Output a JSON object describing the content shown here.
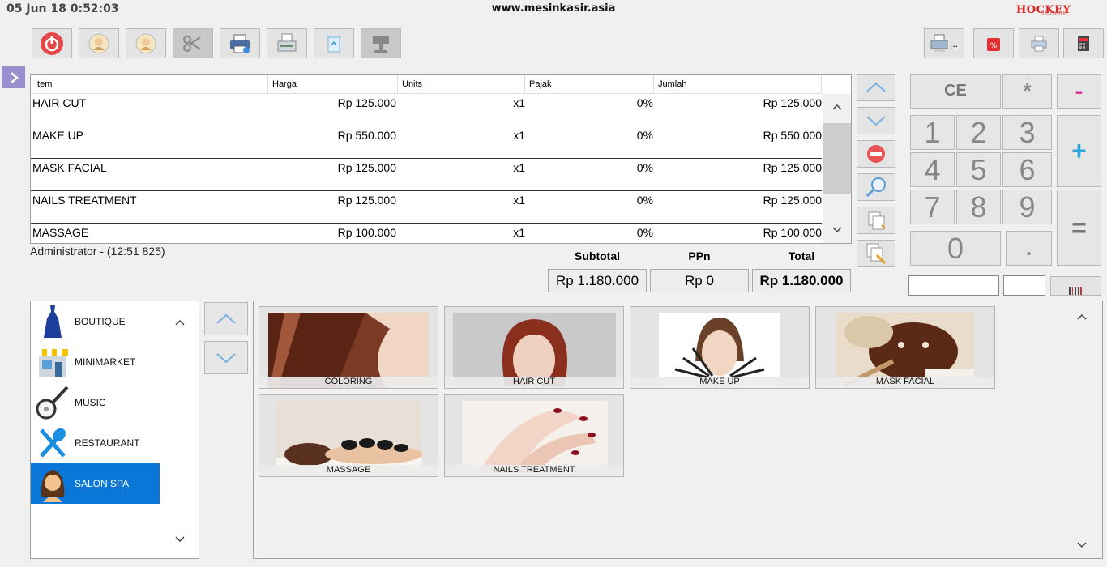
{
  "header": {
    "datetime": "05 Jun 18  0:52:03",
    "website": "www.mesinkasir.asia",
    "logo_text": "HOCKEY",
    "logo_sub": "Software"
  },
  "toolbar": {
    "buttons": [
      {
        "icon": "power-icon",
        "enabled": true
      },
      {
        "icon": "user-login-icon",
        "enabled": true
      },
      {
        "icon": "user-logout-icon",
        "enabled": true
      },
      {
        "icon": "cut-icon",
        "enabled": false
      },
      {
        "icon": "print-icon",
        "enabled": true
      },
      {
        "icon": "receipt-printer-icon",
        "enabled": true
      },
      {
        "icon": "recycle-bin-icon",
        "enabled": true
      },
      {
        "icon": "cashier-desk-icon",
        "enabled": false
      }
    ],
    "right_more_label": "..."
  },
  "grid": {
    "columns": [
      "Item",
      "Harga",
      "Units",
      "Pajak",
      "Jumlah"
    ],
    "rows": [
      {
        "item": "HAIR CUT",
        "harga": "Rp 125.000",
        "units": "x1",
        "pajak": "0%",
        "jumlah": "Rp 125.000"
      },
      {
        "item": "MAKE UP",
        "harga": "Rp 550.000",
        "units": "x1",
        "pajak": "0%",
        "jumlah": "Rp 550.000"
      },
      {
        "item": "MASK FACIAL",
        "harga": "Rp 125.000",
        "units": "x1",
        "pajak": "0%",
        "jumlah": "Rp 125.000"
      },
      {
        "item": "NAILS TREATMENT",
        "harga": "Rp 125.000",
        "units": "x1",
        "pajak": "0%",
        "jumlah": "Rp 125.000"
      },
      {
        "item": "MASSAGE",
        "harga": "Rp 100.000",
        "units": "x1",
        "pajak": "0%",
        "jumlah": "Rp 100.000"
      }
    ]
  },
  "status": {
    "user": "Administrator - (12:51 825)"
  },
  "totals": {
    "subtotal_label": "Subtotal",
    "ppn_label": "PPn",
    "total_label": "Total",
    "subtotal": "Rp 1.180.000",
    "ppn": "Rp 0",
    "total": "Rp 1.180.000"
  },
  "keypad": {
    "ce": "CE",
    "multiply": "*",
    "minus": "-",
    "plus": "+",
    "equals": "=",
    "dot": ".",
    "digits": [
      "1",
      "2",
      "3",
      "4",
      "5",
      "6",
      "7",
      "8",
      "9",
      "0"
    ]
  },
  "categories": [
    {
      "label": "BOUTIQUE",
      "icon": "dress-icon",
      "selected": false
    },
    {
      "label": "MINIMARKET",
      "icon": "store-icon",
      "selected": false
    },
    {
      "label": "MUSIC",
      "icon": "banjo-icon",
      "selected": false
    },
    {
      "label": "RESTAURANT",
      "icon": "cutlery-icon",
      "selected": false
    },
    {
      "label": "SALON SPA",
      "icon": "woman-icon",
      "selected": true
    }
  ],
  "products": [
    {
      "label": "COLORING"
    },
    {
      "label": "HAIR CUT"
    },
    {
      "label": "MAKE UP"
    },
    {
      "label": "MASK FACIAL"
    },
    {
      "label": "MASSAGE"
    },
    {
      "label": "NAILS TREATMENT"
    }
  ],
  "colors": {
    "selected_category": "#0a77d8",
    "plus_key": "#2aa7e0",
    "minus_key": "#e0379a",
    "power_button": "#e54848"
  }
}
